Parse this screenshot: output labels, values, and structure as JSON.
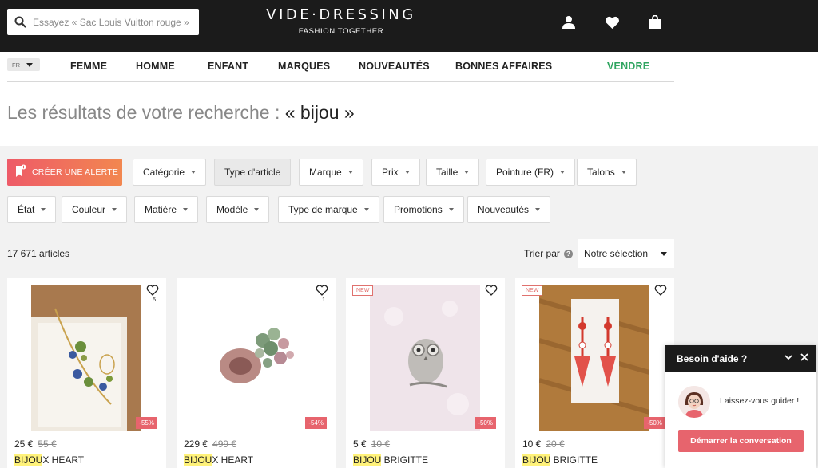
{
  "header": {
    "search_placeholder": "Essayez « Sac Louis Vuitton rouge »",
    "logo_text": "VIDE·DRESSING",
    "logo_tagline": "FASHION TOGETHER"
  },
  "nav": {
    "lang": "FR",
    "items": [
      "FEMME",
      "HOMME",
      "ENFANT",
      "MARQUES",
      "NOUVEAUTÉS",
      "BONNES AFFAIRES"
    ],
    "sell": "VENDRE"
  },
  "search": {
    "title_prefix": "Les résultats de votre recherche :",
    "query": "« bijou »"
  },
  "filters": {
    "alert": "CRÉER UNE ALERTE",
    "row1": [
      "Catégorie",
      "Type d'article",
      "Marque",
      "Prix",
      "Taille",
      "Pointure (FR)",
      "Talons"
    ],
    "row2": [
      "État",
      "Couleur",
      "Matière",
      "Modèle",
      "Type de marque",
      "Promotions",
      "Nouveautés"
    ]
  },
  "results": {
    "count": "17 671 articles",
    "sort_label": "Trier par",
    "sort_help": "?",
    "sort_value": "Notre sélection"
  },
  "products": [
    {
      "likes": "5",
      "new": "",
      "discount": "-55%",
      "price": "25 €",
      "old_price": "55 €",
      "brand_hl": "BIJOU",
      "brand_rest": "X HEART"
    },
    {
      "likes": "1",
      "new": "",
      "discount": "-54%",
      "price": "229 €",
      "old_price": "499 €",
      "brand_hl": "BIJOU",
      "brand_rest": "X HEART"
    },
    {
      "likes": "",
      "new": "NEW",
      "discount": "-50%",
      "price": "5 €",
      "old_price": "10 €",
      "brand_hl": "BIJOU",
      "brand_rest": " BRIGITTE"
    },
    {
      "likes": "",
      "new": "NEW",
      "discount": "-50%",
      "price": "10 €",
      "old_price": "20 €",
      "brand_hl": "BIJOU",
      "brand_rest": " BRIGITTE"
    }
  ],
  "chat": {
    "title": "Besoin d'aide ?",
    "message": "Laissez-vous guider !",
    "button": "Démarrer la conversation"
  },
  "colors": {
    "accent": "#e7646d",
    "sell_green": "#2fa560",
    "header_bg": "#1b1b1b",
    "highlight": "#fff27a"
  }
}
